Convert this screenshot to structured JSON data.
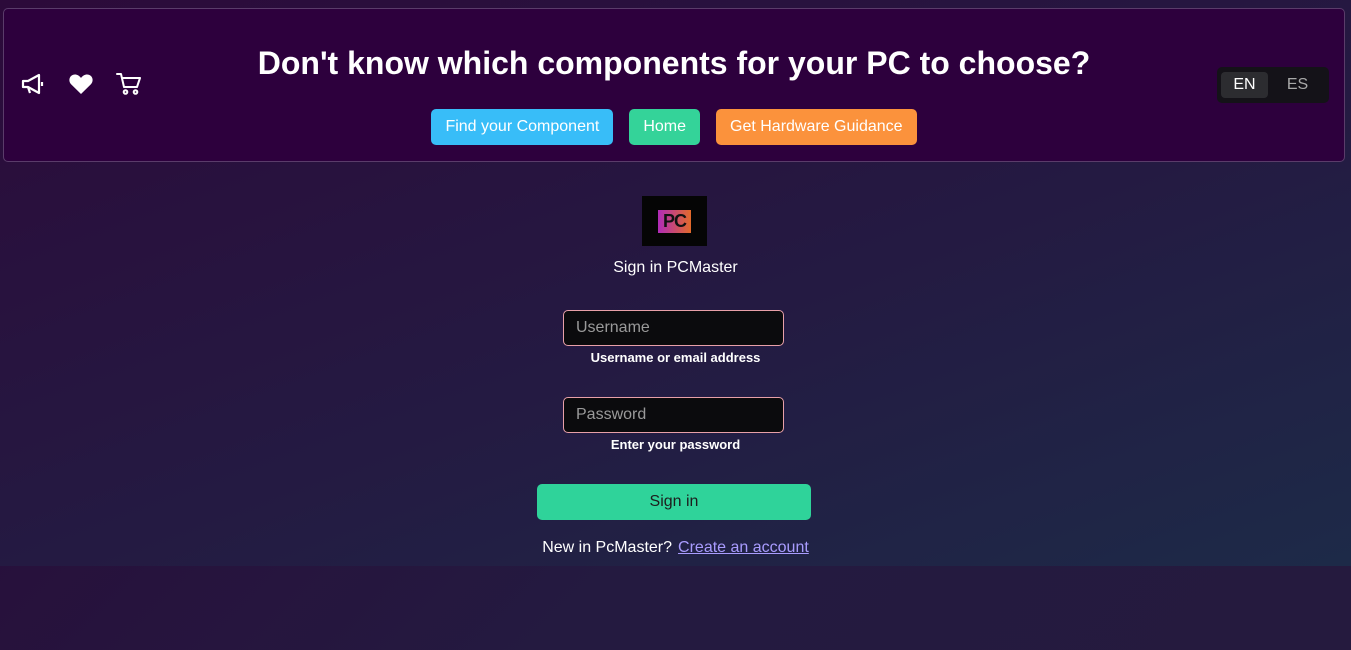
{
  "header": {
    "headline": "Don't know which components for your PC to choose?",
    "icons": [
      "megaphone-icon",
      "heart-icon",
      "cart-icon"
    ],
    "nav": [
      {
        "label": "Find your Component",
        "color": "#38bdf8"
      },
      {
        "label": "Home",
        "color": "#34d399"
      },
      {
        "label": "Get Hardware Guidance",
        "color": "#fb923c"
      }
    ],
    "languages": [
      {
        "label": "EN",
        "active": true
      },
      {
        "label": "ES",
        "active": false
      }
    ]
  },
  "login": {
    "logo_text": "PC",
    "title": "Sign in PCMaster",
    "username": {
      "value": "",
      "placeholder": "Username",
      "hint": "Username or email address"
    },
    "password": {
      "value": "",
      "placeholder": "Password",
      "hint": "Enter your password"
    },
    "submit_label": "Sign in",
    "signup_prompt": "New in PcMaster?",
    "signup_link": "Create an account"
  },
  "colors": {
    "header_bg": "#2d003d",
    "accent_green": "#2fd39a",
    "link": "#a99cff",
    "field_border": "#e8a0a8"
  }
}
